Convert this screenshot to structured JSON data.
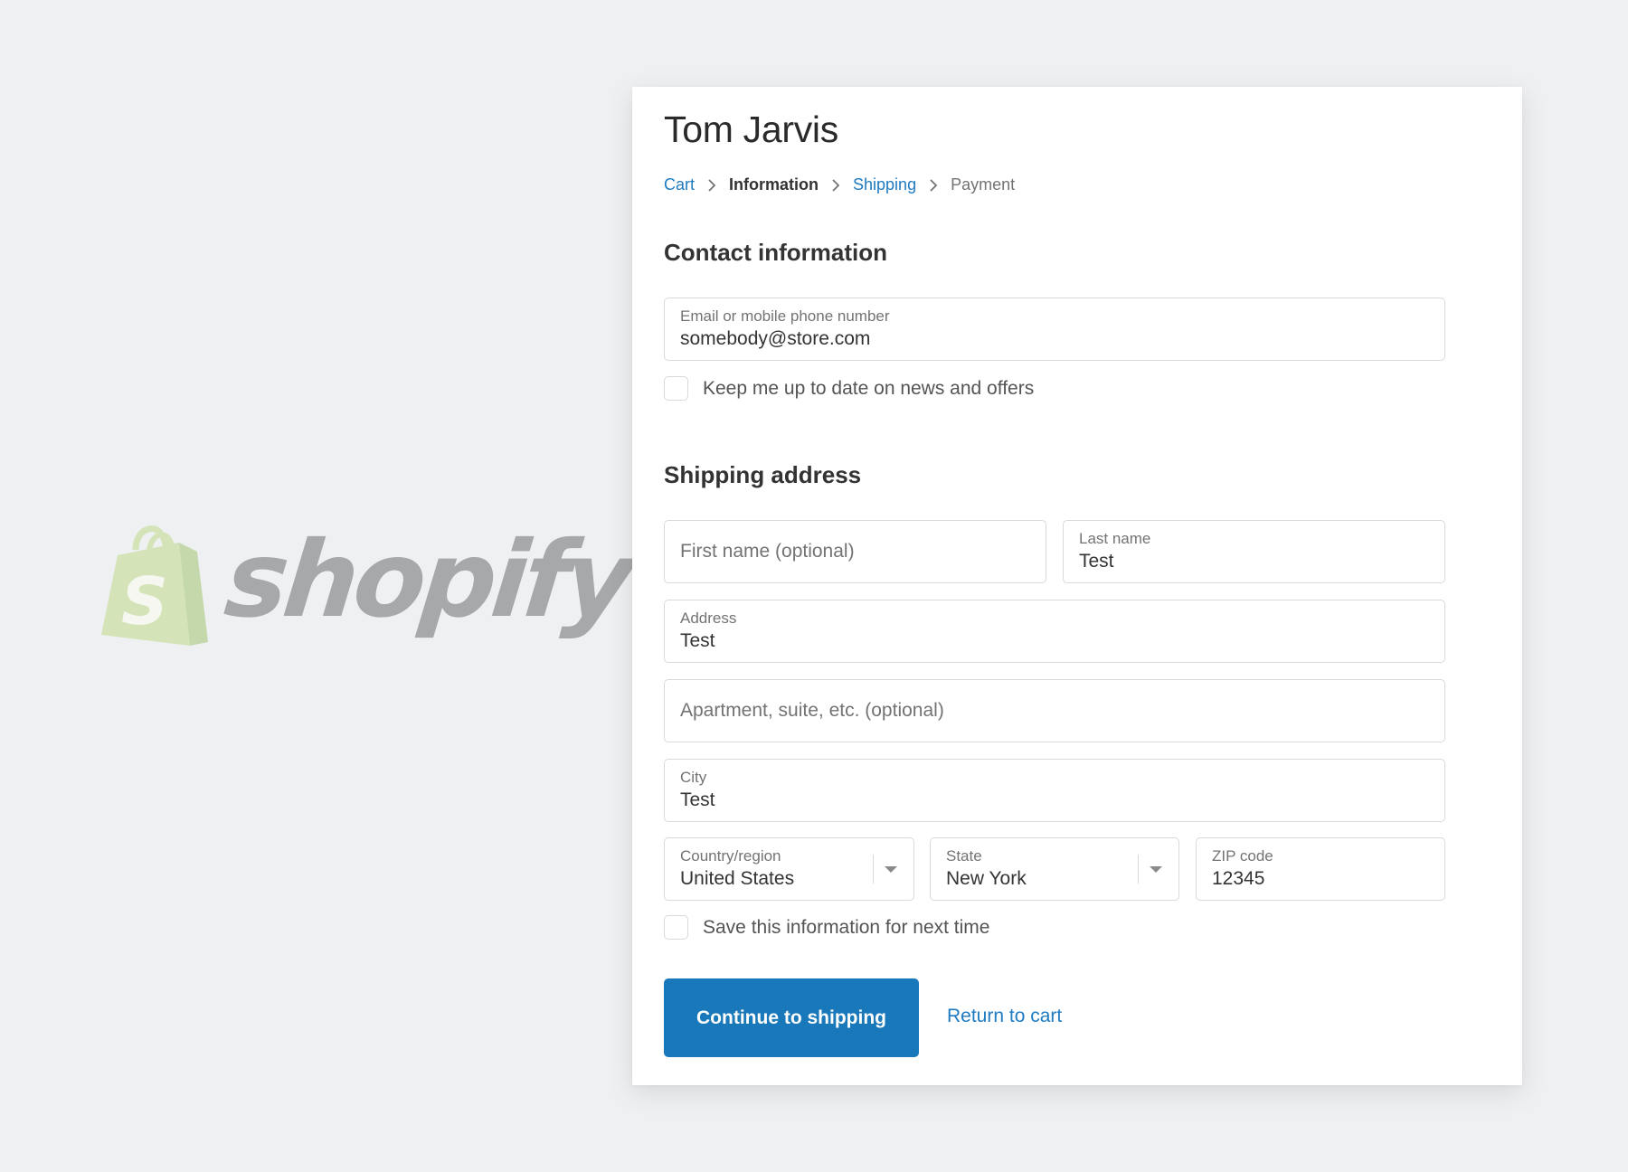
{
  "brand": {
    "logo_text": "shopify",
    "colors": {
      "accent": "#1878b9",
      "link": "#1f7bc1",
      "logo_bag": "#d4e4b8",
      "logo_text": "#a7a8aa",
      "background": "#eff0f2"
    }
  },
  "checkout": {
    "store_name": "Tom Jarvis",
    "breadcrumb": [
      {
        "label": "Cart",
        "state": "link"
      },
      {
        "label": "Information",
        "state": "current"
      },
      {
        "label": "Shipping",
        "state": "link"
      },
      {
        "label": "Payment",
        "state": "inactive"
      }
    ],
    "contact": {
      "title": "Contact information",
      "email_label": "Email or mobile phone number",
      "email_value": "somebody@store.com",
      "newsletter_label": "Keep me up to date on news and offers",
      "newsletter_checked": false
    },
    "shipping": {
      "title": "Shipping address",
      "first_name_placeholder": "First name (optional)",
      "first_name_value": "",
      "last_name_label": "Last name",
      "last_name_value": "Test",
      "address_label": "Address",
      "address_value": "Test",
      "apartment_placeholder": "Apartment, suite, etc. (optional)",
      "apartment_value": "",
      "city_label": "City",
      "city_value": "Test",
      "country_label": "Country/region",
      "country_value": "United States",
      "state_label": "State",
      "state_value": "New York",
      "zip_label": "ZIP code",
      "zip_value": "12345",
      "save_info_label": "Save this information for next time",
      "save_info_checked": false
    },
    "actions": {
      "continue_label": "Continue to shipping",
      "return_label": "Return to cart"
    }
  }
}
